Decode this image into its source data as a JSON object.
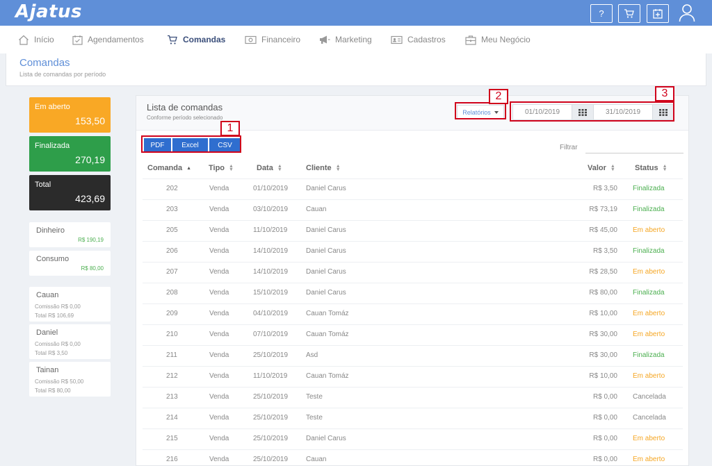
{
  "app": {
    "logo": "Ajatus"
  },
  "topbar": {
    "help": "?",
    "icons": [
      "help-icon",
      "cart-icon",
      "calendar-add-icon",
      "user-icon"
    ]
  },
  "nav": [
    {
      "label": "Início",
      "icon": "home-icon"
    },
    {
      "label": "Agendamentos",
      "icon": "calendar-check-icon"
    },
    {
      "label": "Comandas",
      "icon": "cart-icon"
    },
    {
      "label": "Financeiro",
      "icon": "money-icon"
    },
    {
      "label": "Marketing",
      "icon": "megaphone-icon"
    },
    {
      "label": "Cadastros",
      "icon": "id-card-icon"
    },
    {
      "label": "Meu Negócio",
      "icon": "briefcase-icon"
    }
  ],
  "page": {
    "title": "Comandas",
    "subtitle": "Lista de comandas por período"
  },
  "summary": {
    "em_aberto": {
      "label": "Em aberto",
      "value": "153,50",
      "color": "#f9a825"
    },
    "finalizada": {
      "label": "Finalizada",
      "value": "270,19",
      "color": "#2e9e4a"
    },
    "total": {
      "label": "Total",
      "value": "423,69",
      "color": "#2b2b2b"
    }
  },
  "payment": [
    {
      "label": "Dinheiro",
      "value": "R$ 190,19"
    },
    {
      "label": "Consumo",
      "value": "R$ 80,00"
    }
  ],
  "staff": [
    {
      "name": "Cauan",
      "comissao": "Comissão R$ 0,00",
      "total": "Total R$ 106,69"
    },
    {
      "name": "Daniel",
      "comissao": "Comissão R$ 0,00",
      "total": "Total R$ 3,50"
    },
    {
      "name": "Tainan",
      "comissao": "Comissão R$ 50,00",
      "total": "Total R$ 80,00"
    }
  ],
  "panel": {
    "title": "Lista de comandas",
    "subtitle": "Conforme período selecionado",
    "reports_label": "Relatórios",
    "date_from": "01/10/2019",
    "date_to": "31/10/2019",
    "export": [
      "PDF",
      "Excel",
      "CSV"
    ],
    "filter_label": "Filtrar",
    "filter_value": ""
  },
  "annotations": [
    "1",
    "2",
    "3"
  ],
  "table": {
    "headers": [
      "Comanda",
      "Tipo",
      "Data",
      "Cliente",
      "Valor",
      "Status"
    ],
    "rows": [
      {
        "comanda": "202",
        "tipo": "Venda",
        "data": "01/10/2019",
        "cliente": "Daniel Carus",
        "valor": "R$ 3,50",
        "status": "Finalizada"
      },
      {
        "comanda": "203",
        "tipo": "Venda",
        "data": "03/10/2019",
        "cliente": "Cauan",
        "valor": "R$ 73,19",
        "status": "Finalizada"
      },
      {
        "comanda": "205",
        "tipo": "Venda",
        "data": "11/10/2019",
        "cliente": "Daniel Carus",
        "valor": "R$ 45,00",
        "status": "Em aberto"
      },
      {
        "comanda": "206",
        "tipo": "Venda",
        "data": "14/10/2019",
        "cliente": "Daniel Carus",
        "valor": "R$ 3,50",
        "status": "Finalizada"
      },
      {
        "comanda": "207",
        "tipo": "Venda",
        "data": "14/10/2019",
        "cliente": "Daniel Carus",
        "valor": "R$ 28,50",
        "status": "Em aberto"
      },
      {
        "comanda": "208",
        "tipo": "Venda",
        "data": "15/10/2019",
        "cliente": "Daniel Carus",
        "valor": "R$ 80,00",
        "status": "Finalizada"
      },
      {
        "comanda": "209",
        "tipo": "Venda",
        "data": "04/10/2019",
        "cliente": "Cauan Tomáz",
        "valor": "R$ 10,00",
        "status": "Em aberto"
      },
      {
        "comanda": "210",
        "tipo": "Venda",
        "data": "07/10/2019",
        "cliente": "Cauan Tomáz",
        "valor": "R$ 30,00",
        "status": "Em aberto"
      },
      {
        "comanda": "211",
        "tipo": "Venda",
        "data": "25/10/2019",
        "cliente": "Asd",
        "valor": "R$ 30,00",
        "status": "Finalizada"
      },
      {
        "comanda": "212",
        "tipo": "Venda",
        "data": "11/10/2019",
        "cliente": "Cauan Tomáz",
        "valor": "R$ 10,00",
        "status": "Em aberto"
      },
      {
        "comanda": "213",
        "tipo": "Venda",
        "data": "25/10/2019",
        "cliente": "Teste",
        "valor": "R$ 0,00",
        "status": "Cancelada"
      },
      {
        "comanda": "214",
        "tipo": "Venda",
        "data": "25/10/2019",
        "cliente": "Teste",
        "valor": "R$ 0,00",
        "status": "Cancelada"
      },
      {
        "comanda": "215",
        "tipo": "Venda",
        "data": "25/10/2019",
        "cliente": "Daniel Carus",
        "valor": "R$ 0,00",
        "status": "Em aberto"
      },
      {
        "comanda": "216",
        "tipo": "Venda",
        "data": "25/10/2019",
        "cliente": "Cauan",
        "valor": "R$ 0,00",
        "status": "Em aberto"
      }
    ]
  }
}
